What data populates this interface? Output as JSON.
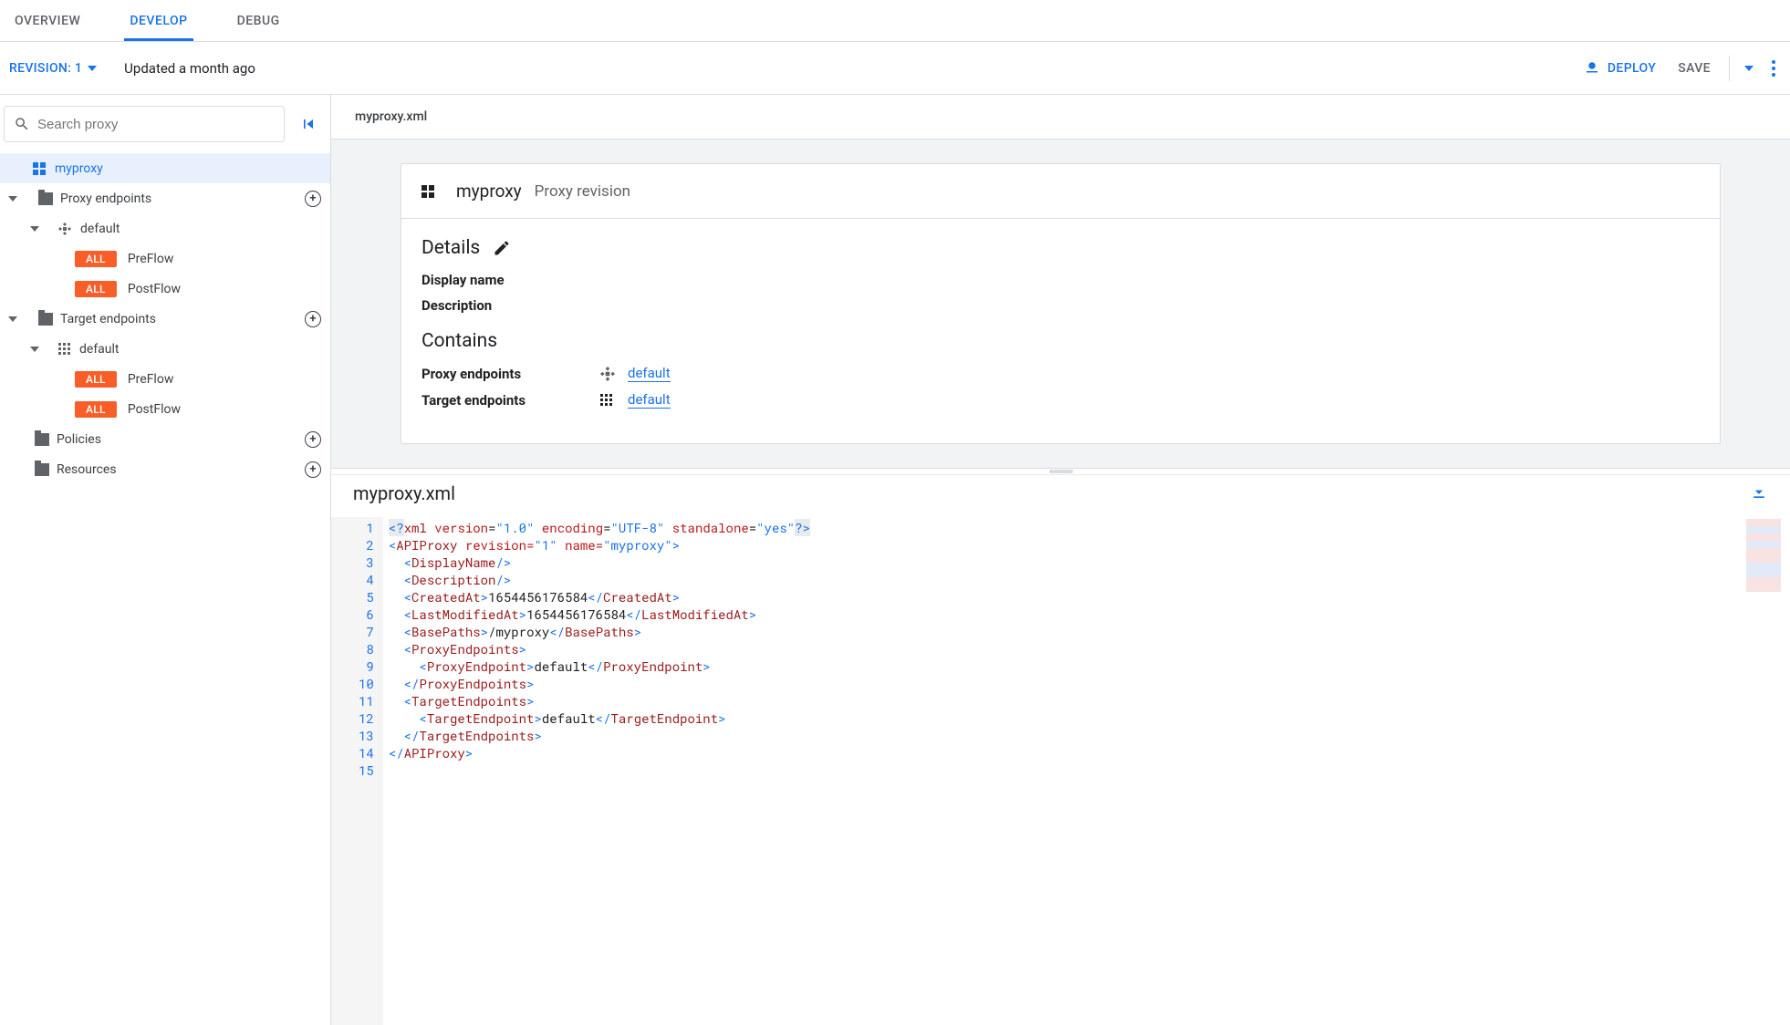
{
  "tabs": {
    "overview": "OVERVIEW",
    "develop": "DEVELOP",
    "debug": "DEBUG"
  },
  "header": {
    "revision_label": "REVISION: 1",
    "updated": "Updated a month ago",
    "deploy": "DEPLOY",
    "save": "SAVE"
  },
  "search": {
    "placeholder": "Search proxy"
  },
  "tree": {
    "root": "myproxy",
    "proxy_endpoints": "Proxy endpoints",
    "target_endpoints": "Target endpoints",
    "policies": "Policies",
    "resources": "Resources",
    "default": "default",
    "all": "ALL",
    "preflow": "PreFlow",
    "postflow": "PostFlow"
  },
  "breadcrumb": "myproxy.xml",
  "card": {
    "title": "myproxy",
    "subtitle": "Proxy revision",
    "details": "Details",
    "display_name_label": "Display name",
    "description_label": "Description",
    "contains": "Contains",
    "proxy_endpoints_label": "Proxy endpoints",
    "target_endpoints_label": "Target endpoints",
    "default_link": "default"
  },
  "code": {
    "filename": "myproxy.xml",
    "lines": [
      "1",
      "2",
      "3",
      "4",
      "5",
      "6",
      "7",
      "8",
      "9",
      "10",
      "11",
      "12",
      "13",
      "14",
      "15"
    ],
    "xml": {
      "pi": "<?xml version=\"1.0\" encoding=\"UTF-8\" standalone=\"yes\"?>",
      "root_open": "<APIProxy revision=\"1\" name=\"myproxy\">",
      "display_name": "<DisplayName/>",
      "description": "<Description/>",
      "created_at_open": "<CreatedAt>",
      "created_at_val": "1654456176584",
      "created_at_close": "</CreatedAt>",
      "last_modified_open": "<LastModifiedAt>",
      "last_modified_val": "1654456176584",
      "last_modified_close": "</LastModifiedAt>",
      "basepaths_open": "<BasePaths>",
      "basepaths_val": "/myproxy",
      "basepaths_close": "</BasePaths>",
      "pe_open": "<ProxyEndpoints>",
      "pe_item_open": "<ProxyEndpoint>",
      "pe_item_val": "default",
      "pe_item_close": "</ProxyEndpoint>",
      "pe_close": "</ProxyEndpoints>",
      "te_open": "<TargetEndpoints>",
      "te_item_open": "<TargetEndpoint>",
      "te_item_val": "default",
      "te_item_close": "</TargetEndpoint>",
      "te_close": "</TargetEndpoints>",
      "root_close": "</APIProxy>"
    }
  }
}
